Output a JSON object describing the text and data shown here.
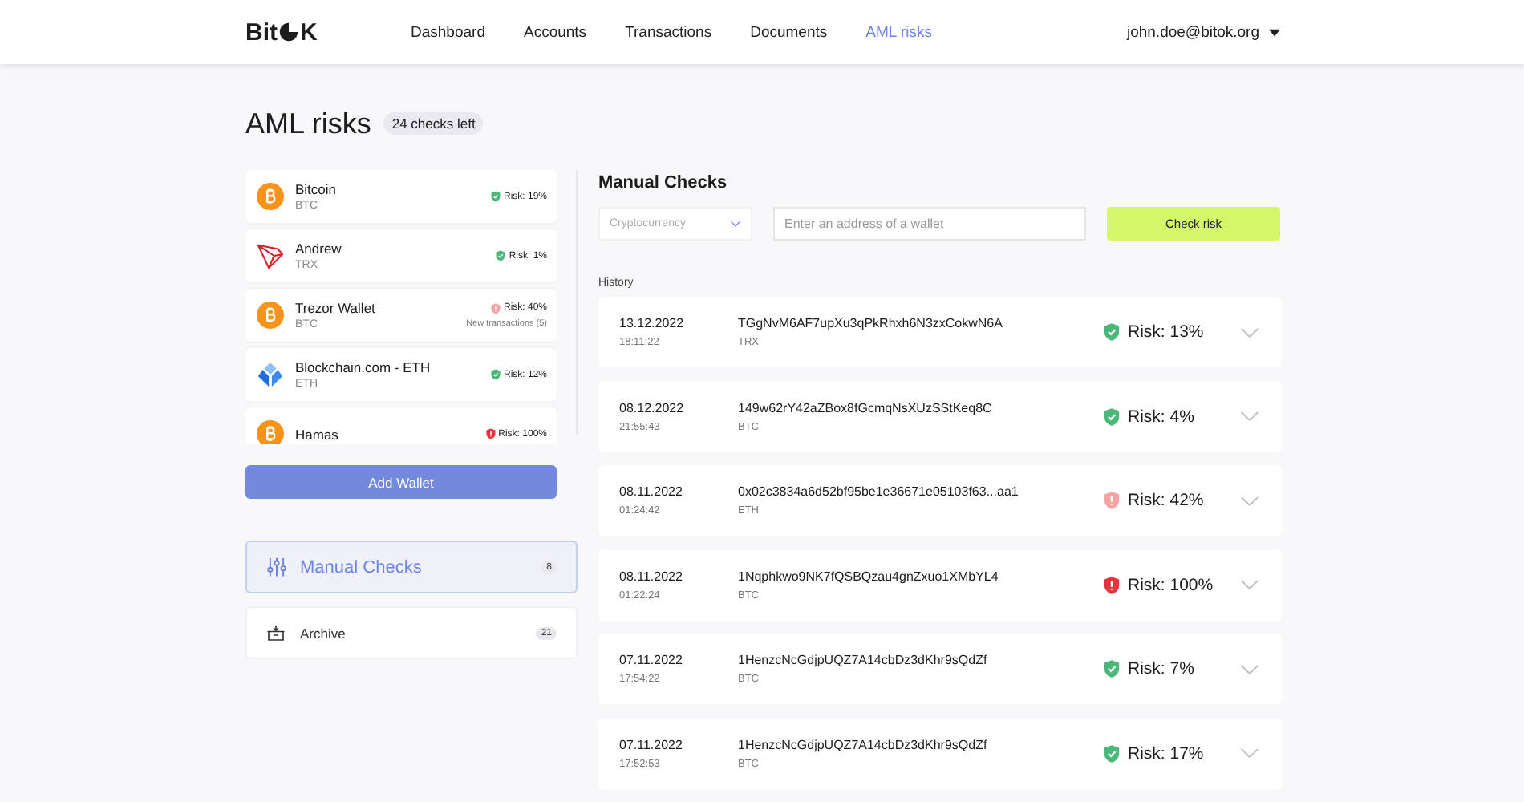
{
  "header": {
    "logo": {
      "left": "Bit",
      "right": "K"
    },
    "nav": [
      {
        "label": "Dashboard",
        "selected": false
      },
      {
        "label": "Accounts",
        "selected": false
      },
      {
        "label": "Transactions",
        "selected": false
      },
      {
        "label": "Documents",
        "selected": false
      },
      {
        "label": "AML risks",
        "selected": true
      }
    ],
    "user": "john.doe@bitok.org"
  },
  "page": {
    "title": "AML risks",
    "badge": "24 checks left"
  },
  "wallets": [
    {
      "name": "Bitcoin",
      "coin": "BTC",
      "kind": "btc",
      "risk": "Risk: 19%",
      "color": "#4cb877"
    },
    {
      "name": "Andrew",
      "coin": "TRX",
      "kind": "trx",
      "risk": "Risk: 1%",
      "color": "#4cb877"
    },
    {
      "name": "Trezor Wallet",
      "coin": "BTC",
      "kind": "btc",
      "risk": "Risk: 40%",
      "color": "#f5a3a3",
      "note": "New transactions (5)"
    },
    {
      "name": "Blockchain.com - ETH",
      "coin": "ETH",
      "kind": "eth",
      "risk": "Risk: 12%",
      "color": "#4cb877"
    },
    {
      "name": "Hamas",
      "kind": "btc",
      "risk": "Risk: 100%",
      "color": "#e5343d"
    }
  ],
  "add_wallet": "Add Wallet",
  "sections": [
    {
      "label": "Manual Checks",
      "count": "8",
      "kind": "sliders",
      "selected": true
    },
    {
      "label": "Archive",
      "count": "21",
      "kind": "archive",
      "selected": false
    }
  ],
  "manual": {
    "title": "Manual Checks",
    "currency": {
      "placeholder": "Cryptocurrency"
    },
    "address": {
      "placeholder": "Enter an address of a wallet"
    },
    "button": "Check risk",
    "history_label": "History"
  },
  "history": [
    {
      "date": "13.12.2022",
      "time": "18:11:22",
      "address": "TGgNvM6AF7upXu3qPkRhxh6N3zxCokwN6A",
      "coin": "TRX",
      "risk": "Risk: 13%",
      "color": "#4cb877"
    },
    {
      "date": "08.12.2022",
      "time": "21:55:43",
      "address": "149w62rY42aZBox8fGcmqNsXUzSStKeq8C",
      "coin": "BTC",
      "risk": "Risk: 4%",
      "color": "#4cb877"
    },
    {
      "date": "08.11.2022",
      "time": "01:24:42",
      "address": "0x02c3834a6d52bf95be1e36671e05103f63...aa1",
      "coin": "ETH",
      "risk": "Risk: 42%",
      "color": "#f5a3a3"
    },
    {
      "date": "08.11.2022",
      "time": "01:22:24",
      "address": "1Nqphkwo9NK7fQSBQzau4gnZxuo1XMbYL4",
      "coin": "BTC",
      "risk": "Risk: 100%",
      "color": "#e5343d"
    },
    {
      "date": "07.11.2022",
      "time": "17:54:22",
      "address": "1HenzcNcGdjpUQZ7A14cbDz3dKhr9sQdZf",
      "coin": "BTC",
      "risk": "Risk: 7%",
      "color": "#4cb877"
    },
    {
      "date": "07.11.2022",
      "time": "17:52:53",
      "address": "1HenzcNcGdjpUQZ7A14cbDz3dKhr9sQdZf",
      "coin": "BTC",
      "risk": "Risk: 17%",
      "color": "#4cb877"
    }
  ]
}
